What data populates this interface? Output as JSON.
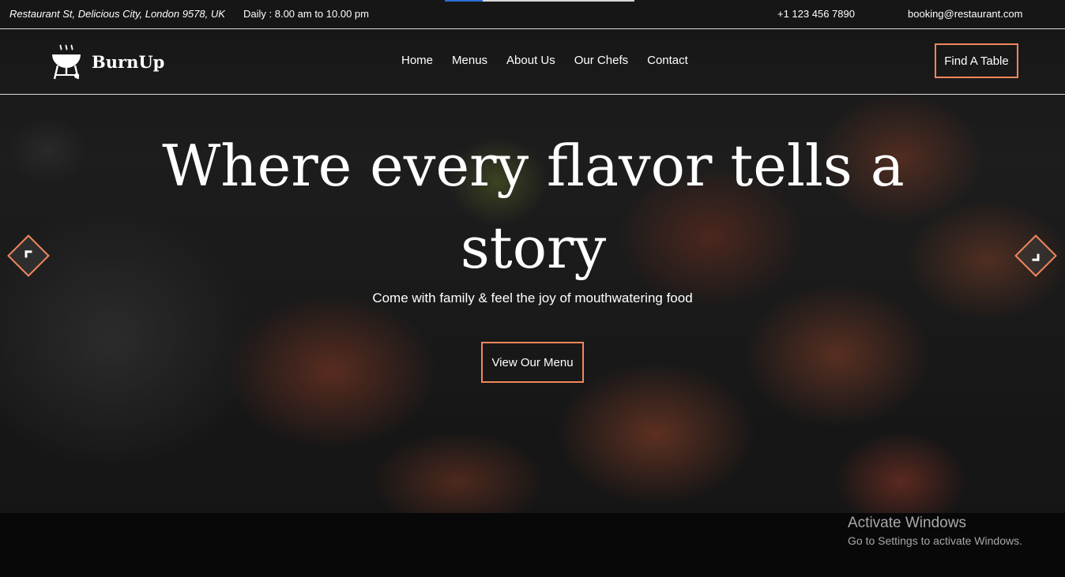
{
  "topbar": {
    "address": "Restaurant St, Delicious City, London 9578, UK",
    "hours": "Daily : 8.00 am to 10.00 pm",
    "phone": "+1 123 456 7890",
    "email": "booking@restaurant.com"
  },
  "brand": {
    "name": "BurnUp",
    "logo_icon": "grill-icon"
  },
  "nav": {
    "links": [
      "Home",
      "Menus",
      "About Us",
      "Our Chefs",
      "Contact"
    ],
    "cta_label": "Find A Table"
  },
  "hero": {
    "headline": "Where every flavor tells a story",
    "subline": "Come with family & feel the joy of mouthwatering food",
    "cta_label": "View Our Menu",
    "prev_icon": "arrow-left-icon",
    "next_icon": "arrow-right-icon"
  },
  "watermark": {
    "title": "Activate Windows",
    "subtitle": "Go to Settings to activate Windows."
  },
  "colors": {
    "accent": "#f0875d",
    "background": "#080808",
    "text": "#ffffff"
  }
}
